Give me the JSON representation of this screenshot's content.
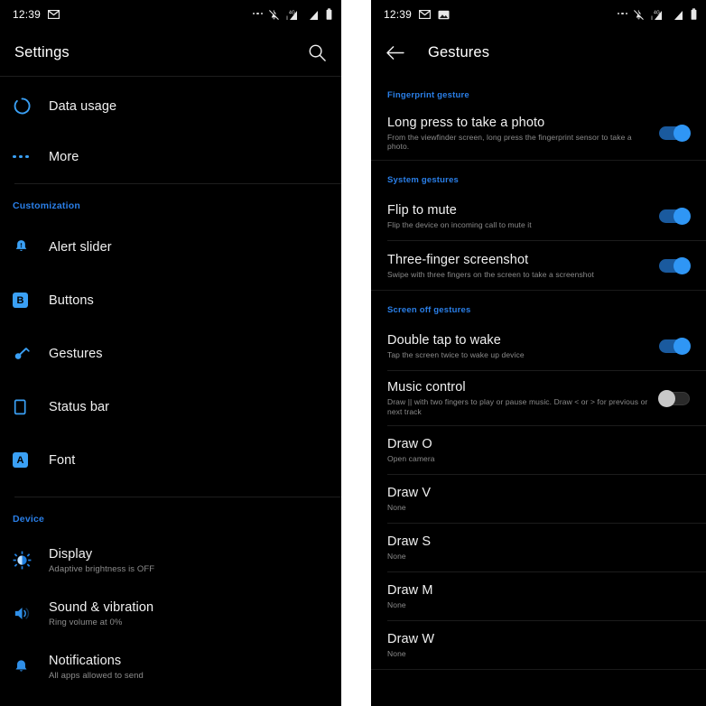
{
  "left": {
    "statusbar": {
      "time": "12:39",
      "left_icons": [
        "gmail-icon"
      ],
      "right_icons": [
        "more-dots-icon",
        "notifications-muted-icon",
        "signal-4g-icon",
        "signal-bars-icon",
        "battery-icon"
      ]
    },
    "appbar": {
      "title": "Settings",
      "search_icon": "search-icon"
    },
    "items": [
      {
        "icon": "data-usage-icon",
        "title": "Data usage",
        "sub": ""
      },
      {
        "icon": "more-dots-icon",
        "title": "More",
        "sub": ""
      }
    ],
    "sections": [
      {
        "header": "Customization",
        "items": [
          {
            "icon": "alert-slider-icon",
            "title": "Alert slider",
            "sub": ""
          },
          {
            "icon": "buttons-icon",
            "title": "Buttons",
            "sub": ""
          },
          {
            "icon": "gestures-icon",
            "title": "Gestures",
            "sub": ""
          },
          {
            "icon": "status-bar-icon",
            "title": "Status bar",
            "sub": ""
          },
          {
            "icon": "font-icon",
            "title": "Font",
            "sub": ""
          }
        ]
      },
      {
        "header": "Device",
        "items": [
          {
            "icon": "display-brightness-icon",
            "title": "Display",
            "sub": "Adaptive brightness is OFF"
          },
          {
            "icon": "sound-volume-icon",
            "title": "Sound & vibration",
            "sub": "Ring volume at 0%"
          },
          {
            "icon": "notifications-bell-icon",
            "title": "Notifications",
            "sub": "All apps allowed to send"
          }
        ]
      }
    ]
  },
  "right": {
    "statusbar": {
      "time": "12:39",
      "left_icons": [
        "gmail-icon",
        "screenshot-image-icon"
      ],
      "right_icons": [
        "more-dots-icon",
        "notifications-muted-icon",
        "signal-4g-icon",
        "signal-bars-icon",
        "battery-icon"
      ]
    },
    "appbar": {
      "back_icon": "back-arrow-icon",
      "title": "Gestures"
    },
    "sections": [
      {
        "header": "Fingerprint gesture",
        "rows": [
          {
            "title": "Long press to take a photo",
            "sub": "From the viewfinder screen, long press the fingerprint sensor to take a photo.",
            "toggle": "on"
          }
        ]
      },
      {
        "header": "System gestures",
        "rows": [
          {
            "title": "Flip to mute",
            "sub": "Flip the device on incoming call to mute it",
            "toggle": "on"
          },
          {
            "title": "Three-finger screenshot",
            "sub": "Swipe with three fingers on the screen to take a screenshot",
            "toggle": "on"
          }
        ]
      },
      {
        "header": "Screen off gestures",
        "rows": [
          {
            "title": "Double tap to wake",
            "sub": "Tap the screen twice to wake up device",
            "toggle": "on"
          },
          {
            "title": "Music control",
            "sub": "Draw || with two fingers to play or pause music. Draw < or > for previous or next track",
            "toggle": "off"
          },
          {
            "title": "Draw O",
            "sub": "Open camera",
            "toggle": "none"
          },
          {
            "title": "Draw V",
            "sub": "None",
            "toggle": "none"
          },
          {
            "title": "Draw S",
            "sub": "None",
            "toggle": "none"
          },
          {
            "title": "Draw M",
            "sub": "None",
            "toggle": "none"
          },
          {
            "title": "Draw W",
            "sub": "None",
            "toggle": "none"
          }
        ]
      }
    ]
  },
  "colors": {
    "background": "#000000",
    "accent_blue": "#2a7fe8",
    "icon_blue": "#3aa0f5",
    "toggle_on": "#2f96f5",
    "toggle_off_knob": "#c8c8c8",
    "primary_text": "#f1f1f1",
    "secondary_text": "#8b8b8b"
  }
}
